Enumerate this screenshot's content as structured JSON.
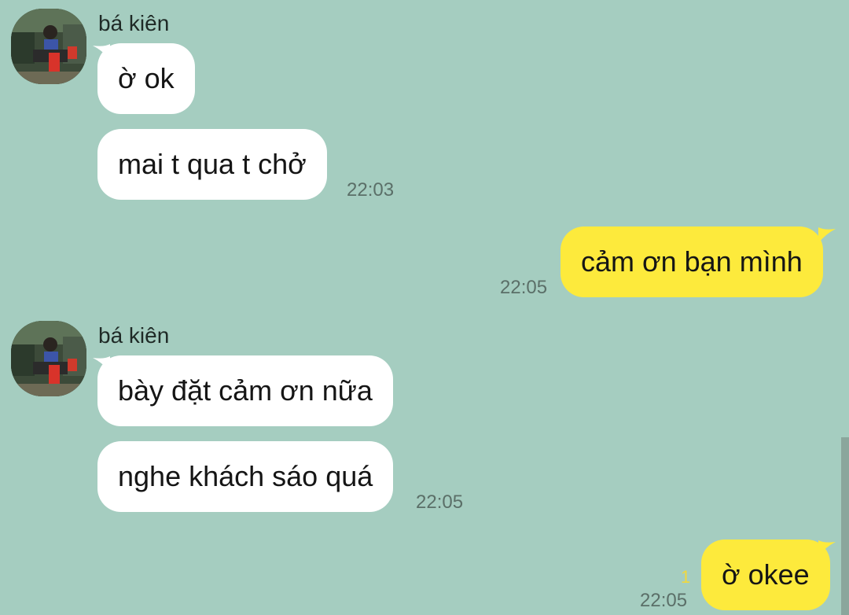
{
  "messages": {
    "group1": {
      "sender": "bá kiên",
      "bubbles": [
        "ờ ok",
        "mai t qua t chở"
      ],
      "time": "22:03"
    },
    "reply1": {
      "text": "cảm ơn bạn mình",
      "time": "22:05"
    },
    "group2": {
      "sender": "bá kiên",
      "bubbles": [
        "bày đặt cảm ơn nữa",
        "nghe khách sáo quá"
      ],
      "time": "22:05"
    },
    "reply2": {
      "text": "ờ okee",
      "time": "22:05",
      "unread_count": "1"
    }
  },
  "colors": {
    "background": "#a5cdc0",
    "incoming_bubble": "#ffffff",
    "outgoing_bubble": "#fdea3c",
    "timestamp": "#5b6f68",
    "unread_marker": "#f2d93b"
  },
  "icons": {
    "avatar": "profile-photo-avatar"
  }
}
